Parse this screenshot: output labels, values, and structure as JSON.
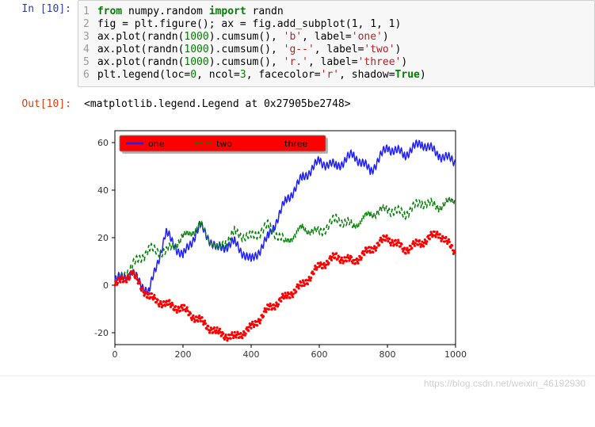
{
  "in_cell": {
    "prompt": "In [10]:",
    "linenos": [
      "1",
      "2",
      "3",
      "4",
      "5",
      "6"
    ],
    "code": {
      "l1a": "from",
      "l1b": " numpy.random ",
      "l1c": "import",
      "l1d": " randn",
      "l2": "fig = plt.figure(); ax = fig.add_subplot(1, 1, 1)",
      "l3a": "ax.plot(randn(",
      "l3n": "1000",
      "l3b": ").cumsum(), ",
      "l3s1": "'b'",
      "l3c": ", label=",
      "l3s2": "'one'",
      "l3d": ")",
      "l4a": "ax.plot(randn(",
      "l4n": "1000",
      "l4b": ").cumsum(), ",
      "l4s1": "'g--'",
      "l4c": ", label=",
      "l4s2": "'two'",
      "l4d": ")",
      "l5a": "ax.plot(randn(",
      "l5n": "1000",
      "l5b": ").cumsum(), ",
      "l5s1": "'r.'",
      "l5c": ", label=",
      "l5s2": "'three'",
      "l5d": ")",
      "l6a": "plt.legend(loc=",
      "l6n1": "0",
      "l6b": ", ncol=",
      "l6n2": "3",
      "l6c": ", facecolor=",
      "l6s": "'r'",
      "l6d": ", shadow=",
      "l6t": "True",
      "l6e": ")"
    }
  },
  "out_cell": {
    "prompt": "Out[10]:",
    "repr": "<matplotlib.legend.Legend at 0x27905be2748>"
  },
  "watermark": "https://blog.csdn.net/weixin_46192930",
  "chart_data": {
    "type": "line",
    "legend": [
      "one",
      "two",
      "three"
    ],
    "legend_facecolor": "#ff0000",
    "xlim": [
      0,
      1000
    ],
    "ylim": [
      -25,
      65
    ],
    "xticks": [
      0,
      200,
      400,
      600,
      800,
      1000
    ],
    "yticks": [
      -20,
      0,
      20,
      40,
      60
    ],
    "series": [
      {
        "name": "one",
        "style": "b",
        "x": [
          0,
          50,
          100,
          150,
          200,
          250,
          300,
          350,
          400,
          450,
          500,
          550,
          600,
          650,
          700,
          750,
          800,
          850,
          900,
          950,
          999
        ],
        "y": [
          2,
          5,
          -3,
          22,
          12,
          25,
          15,
          18,
          10,
          20,
          35,
          45,
          52,
          50,
          55,
          48,
          58,
          55,
          60,
          55,
          52
        ]
      },
      {
        "name": "two",
        "style": "g--",
        "x": [
          0,
          50,
          100,
          150,
          200,
          250,
          300,
          350,
          400,
          450,
          500,
          550,
          600,
          650,
          700,
          750,
          800,
          850,
          900,
          950,
          999
        ],
        "y": [
          0,
          8,
          15,
          14,
          20,
          25,
          15,
          22,
          20,
          25,
          18,
          24,
          22,
          28,
          25,
          30,
          32,
          30,
          35,
          33,
          36
        ]
      },
      {
        "name": "three",
        "style": "r.",
        "x": [
          0,
          50,
          100,
          150,
          200,
          250,
          300,
          350,
          400,
          450,
          500,
          550,
          600,
          650,
          700,
          750,
          800,
          850,
          900,
          950,
          999
        ],
        "y": [
          0,
          5,
          -5,
          -8,
          -10,
          -15,
          -20,
          -22,
          -18,
          -10,
          -5,
          0,
          8,
          12,
          10,
          15,
          20,
          15,
          18,
          22,
          14
        ]
      }
    ]
  }
}
